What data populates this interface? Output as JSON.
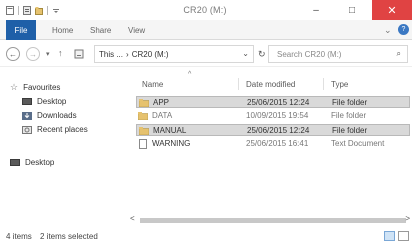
{
  "window": {
    "title": "CR20 (M:)",
    "minimize_glyph": "–",
    "maximize_glyph": "□",
    "close_glyph": "✕"
  },
  "ribbon": {
    "tabs": [
      "File",
      "Home",
      "Share",
      "View"
    ],
    "expand_glyph": "⌄",
    "help_glyph": "?"
  },
  "address": {
    "back_glyph": "←",
    "forward_glyph": "→",
    "recent_glyph": "▾",
    "up_glyph": "↑",
    "parts": [
      "This ...",
      "›",
      "CR20 (M:)"
    ],
    "dropdown_glyph": "⌄",
    "refresh_glyph": "↻",
    "search_placeholder": "Search CR20 (M:)",
    "search_glyph": "⌕"
  },
  "nav_pane": {
    "favourites_label": "Favourites",
    "items": [
      {
        "label": "Desktop",
        "icon": "desktop-icon"
      },
      {
        "label": "Downloads",
        "icon": "downloads-icon"
      },
      {
        "label": "Recent places",
        "icon": "recent-places-icon"
      }
    ],
    "desktop_label": "Desktop"
  },
  "file_list": {
    "columns": [
      "Name",
      "Date modified",
      "Type"
    ],
    "sort_glyph": "^",
    "rows": [
      {
        "name": "APP",
        "date": "25/06/2015 12:24",
        "type": "File folder",
        "selected": true,
        "icon": "folder-icon"
      },
      {
        "name": "DATA",
        "date": "10/09/2015 19:54",
        "type": "File folder",
        "selected": false,
        "icon": "folder-icon"
      },
      {
        "name": "MANUAL",
        "date": "25/06/2015 12:24",
        "type": "File folder",
        "selected": true,
        "icon": "folder-icon"
      },
      {
        "name": "WARNING",
        "date": "25/06/2015 16:41",
        "type": "Text Document",
        "selected": false,
        "icon": "text-document-icon"
      }
    ]
  },
  "scrollbar": {
    "left_glyph": "<",
    "right_glyph": ">"
  },
  "status": {
    "item_count": "4 items",
    "selection": "2 items selected"
  },
  "colors": {
    "file_tab": "#1e5fa8",
    "close_button": "#e04343",
    "selected_row": "#d9d9d9",
    "folder": "#e6c26e"
  }
}
